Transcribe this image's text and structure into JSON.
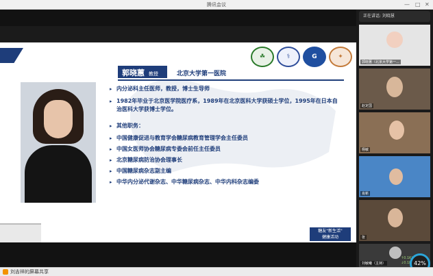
{
  "window": {
    "title": "腾讯会议"
  },
  "slide": {
    "name": "郭晓蕙",
    "name_title": "教授",
    "hospital": "北京大学第一医院",
    "bullets": [
      "内分泌科主任医师，教授，博士生导师",
      "1982年毕业于北京医学院医疗系，1989年在北京医科大学获硕士学位，1995年在日本自治医科大学获博士学位。",
      "其他职务：",
      "中国健康促进与教育学会糖尿病教育管理学会主任委员",
      "中国女医师协会糖尿病专委会前任主任委员",
      "北京糖尿病防治协会理事长",
      "中国糖尿病杂志副主编",
      "中华内分泌代谢杂志、中华糖尿病杂志、中华内科杂志编委"
    ],
    "footer_badge": "糖友\"新生活\"\n健康活动"
  },
  "sidebar": {
    "participant_header": "正在讲话: 刘晓慧",
    "tiles": [
      {
        "label": "郭晓蕙（北京大学第一..."
      },
      {
        "label": "赵定国"
      },
      {
        "label": "杨敏"
      },
      {
        "label": "肖新"
      },
      {
        "label": "张"
      },
      {
        "label": "刘敏曦（主持）"
      }
    ]
  },
  "bottombar": {
    "share_label": "刘吉祥的屏幕共享"
  },
  "status": {
    "progress": "42%",
    "up": "0.1K/s",
    "down": "0.1K/s"
  },
  "colors": {
    "accent": "#1e3d7a",
    "share_icon": "#f39200",
    "progress_ring": "#2ba5d9"
  }
}
